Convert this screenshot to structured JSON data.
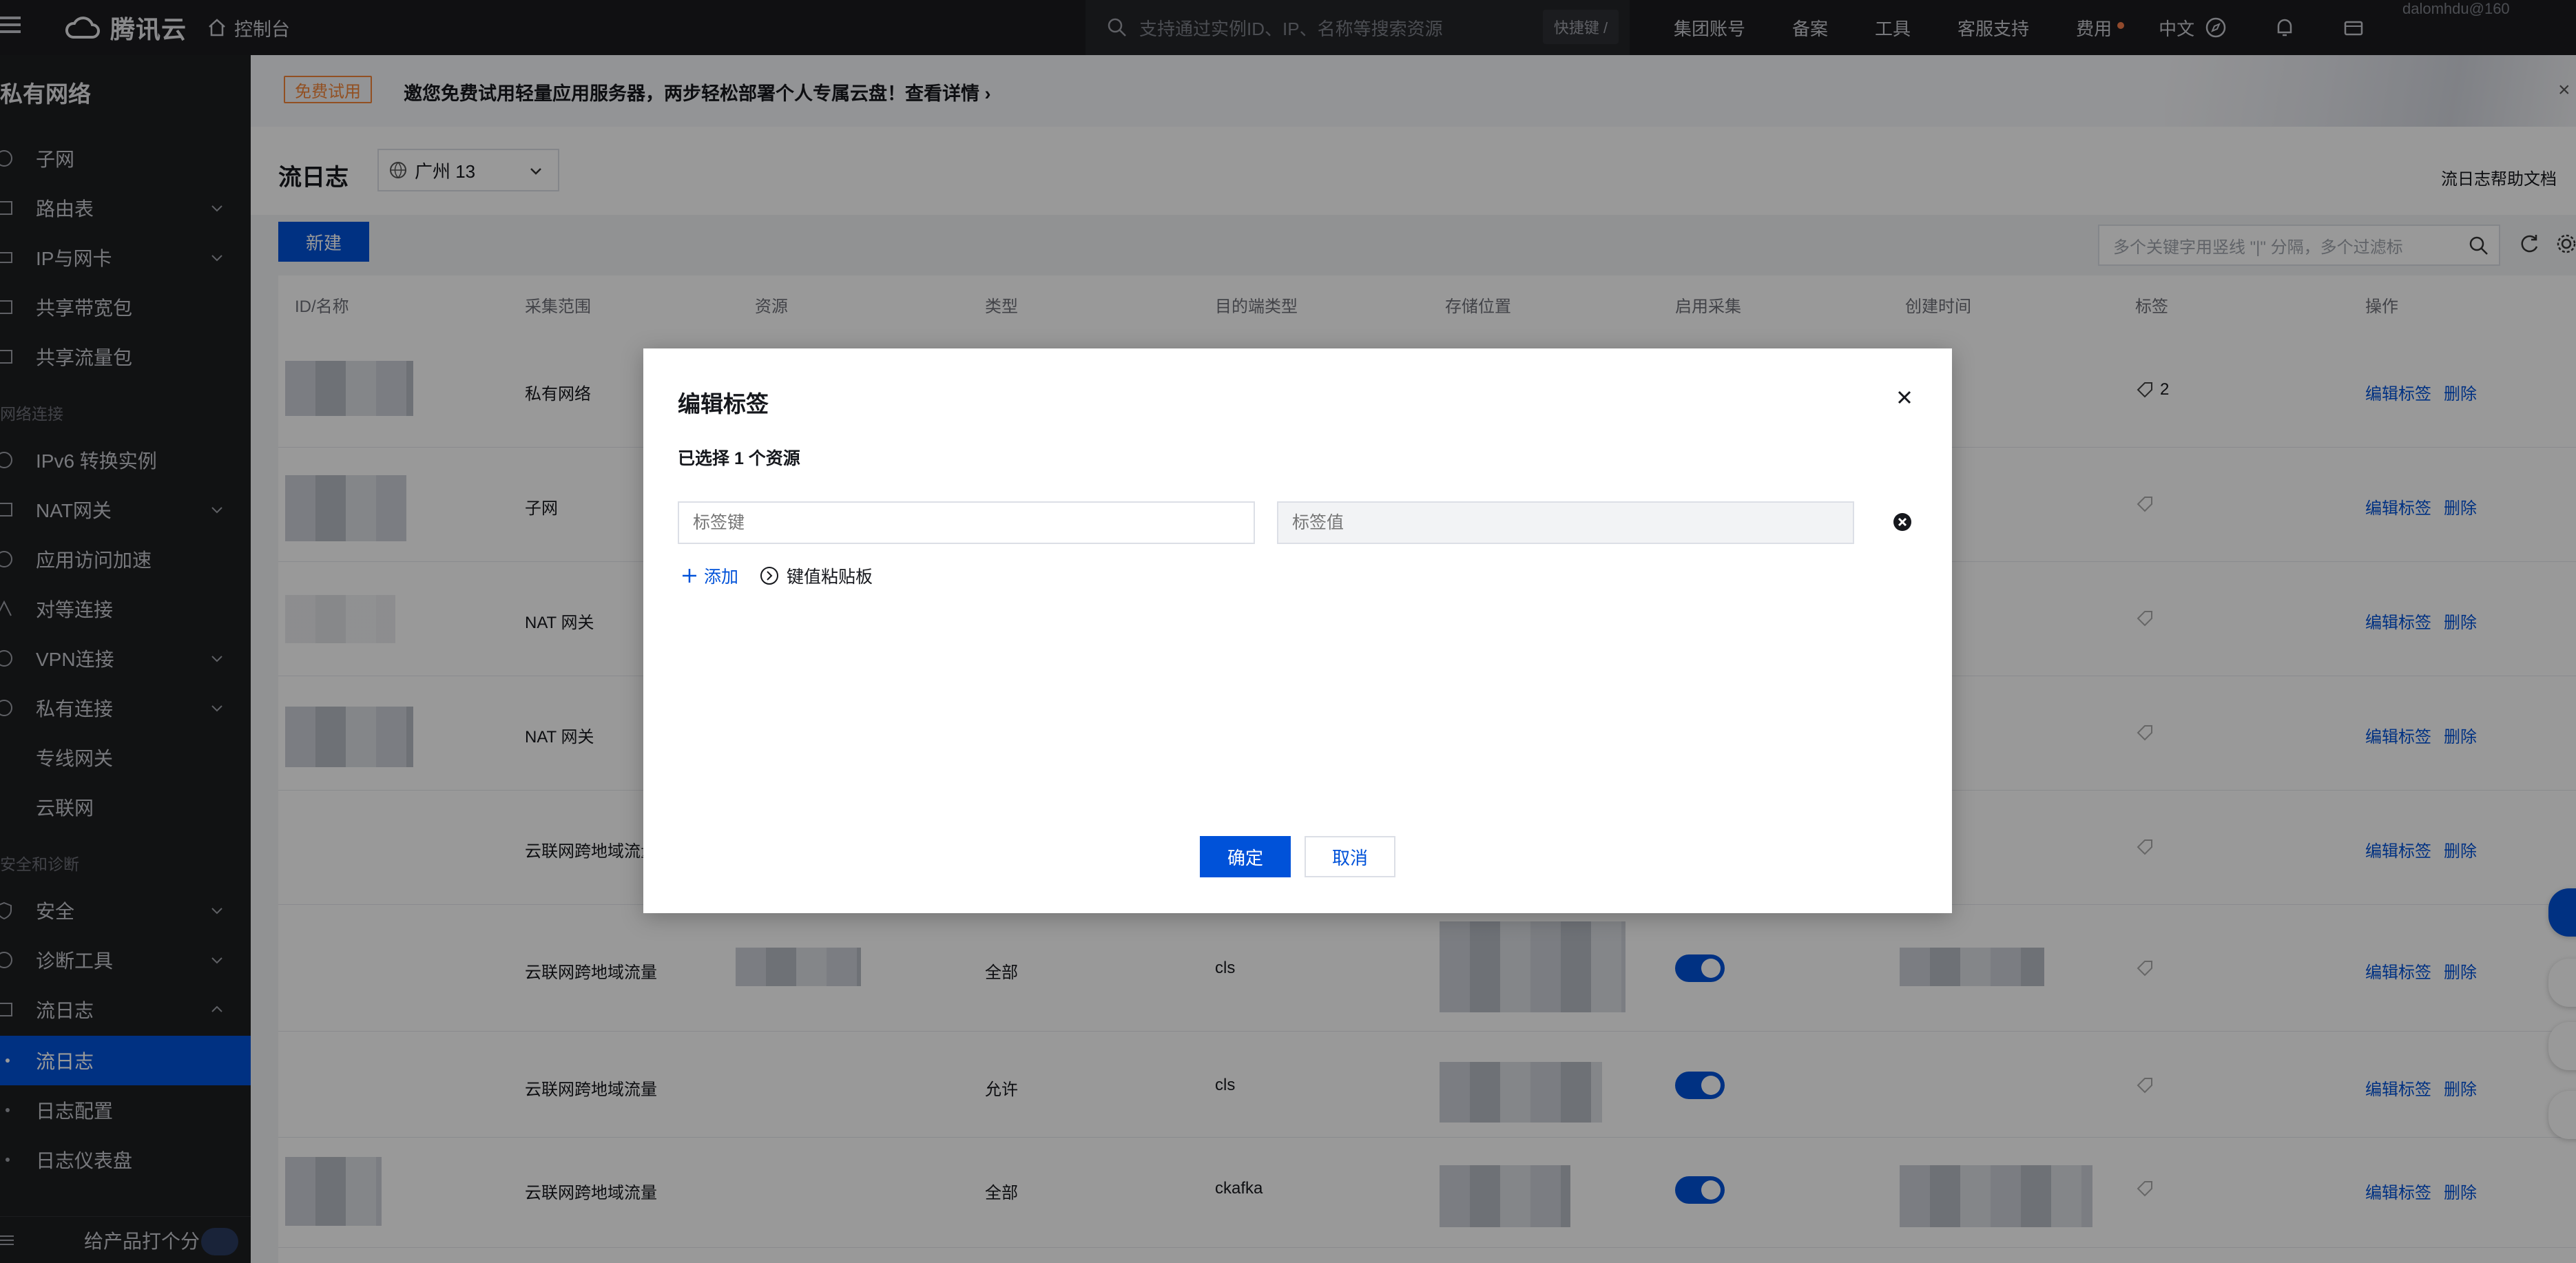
{
  "topbar": {
    "brand": "腾讯云",
    "console": "控制台",
    "search_placeholder": "支持通过实例ID、IP、名称等搜索资源",
    "shortcut": "快捷键 /",
    "links": [
      "集团账号",
      "备案",
      "工具",
      "客服支持",
      "费用",
      "中文"
    ],
    "user": "dalomhdu@160"
  },
  "sidebar": {
    "title": "私有网络",
    "items": [
      {
        "label": "子网",
        "icon": "subnet-icon"
      },
      {
        "label": "路由表",
        "icon": "route-table-icon"
      },
      {
        "label": "IP与网卡",
        "icon": "ip-nic-icon"
      },
      {
        "label": "共享带宽包",
        "icon": "bandwidth-icon"
      },
      {
        "label": "共享流量包",
        "icon": "traffic-icon"
      }
    ],
    "group_network": "网络连接",
    "network_items": [
      {
        "label": "IPv6 转换实例"
      },
      {
        "label": "NAT网关"
      },
      {
        "label": "应用访问加速"
      },
      {
        "label": "对等连接"
      },
      {
        "label": "VPN连接"
      },
      {
        "label": "私有连接"
      },
      {
        "label": "专线网关"
      },
      {
        "label": "云联网"
      }
    ],
    "group_security": "安全和诊断",
    "security_items": [
      {
        "label": "安全"
      },
      {
        "label": "诊断工具"
      },
      {
        "label": "流日志"
      }
    ],
    "sub_items": [
      {
        "label": "流日志"
      },
      {
        "label": "日志配置"
      },
      {
        "label": "日志仪表盘"
      }
    ],
    "footer": "给产品打个分"
  },
  "promo": {
    "tag": "免费试用",
    "text": "邀您免费试用轻量应用服务器，两步轻松部署个人专属云盘！",
    "more": "查看详情"
  },
  "header": {
    "title": "流日志",
    "region": "广州 13",
    "help": "流日志帮助文档"
  },
  "toolbar": {
    "new_button": "新建",
    "search_placeholder": "多个关键字用竖线 \"|\" 分隔，多个过滤标"
  },
  "table": {
    "columns": [
      "ID/名称",
      "采集范围",
      "资源",
      "类型",
      "目的端类型",
      "存储位置",
      "启用采集",
      "创建时间",
      "标签",
      "操作"
    ],
    "rows": [
      {
        "scope": "私有网络",
        "type": "",
        "dest": "",
        "enabled": null,
        "tag": "2"
      },
      {
        "scope": "子网",
        "type": "",
        "dest": "",
        "enabled": null,
        "tag": ""
      },
      {
        "scope": "NAT 网关",
        "type": "",
        "dest": "",
        "enabled": null,
        "tag": ""
      },
      {
        "scope": "NAT 网关",
        "type": "",
        "dest": "",
        "enabled": null,
        "tag": ""
      },
      {
        "scope": "云联网跨地域流量",
        "type": "",
        "dest": "",
        "enabled": null,
        "tag": ""
      },
      {
        "scope": "云联网跨地域流量",
        "type": "全部",
        "dest": "cls",
        "enabled": true,
        "tag": ""
      },
      {
        "scope": "云联网跨地域流量",
        "type": "允许",
        "dest": "cls",
        "enabled": true,
        "tag": ""
      },
      {
        "scope": "云联网跨地域流量",
        "type": "全部",
        "dest": "ckafka",
        "enabled": true,
        "tag": ""
      }
    ],
    "action_edit": "编辑标签",
    "action_delete": "删除"
  },
  "dialog": {
    "title": "编辑标签",
    "selected": "已选择 1 个资源",
    "key_placeholder": "标签键",
    "value_placeholder": "标签值",
    "add": "添加",
    "paste": "键值粘贴板",
    "ok": "确定",
    "cancel": "取消"
  },
  "colors": {
    "accent": "#0052d9",
    "topbar": "#1b1c1e",
    "sidebar": "#1d1e21",
    "promo_tag": "#f4863a"
  }
}
